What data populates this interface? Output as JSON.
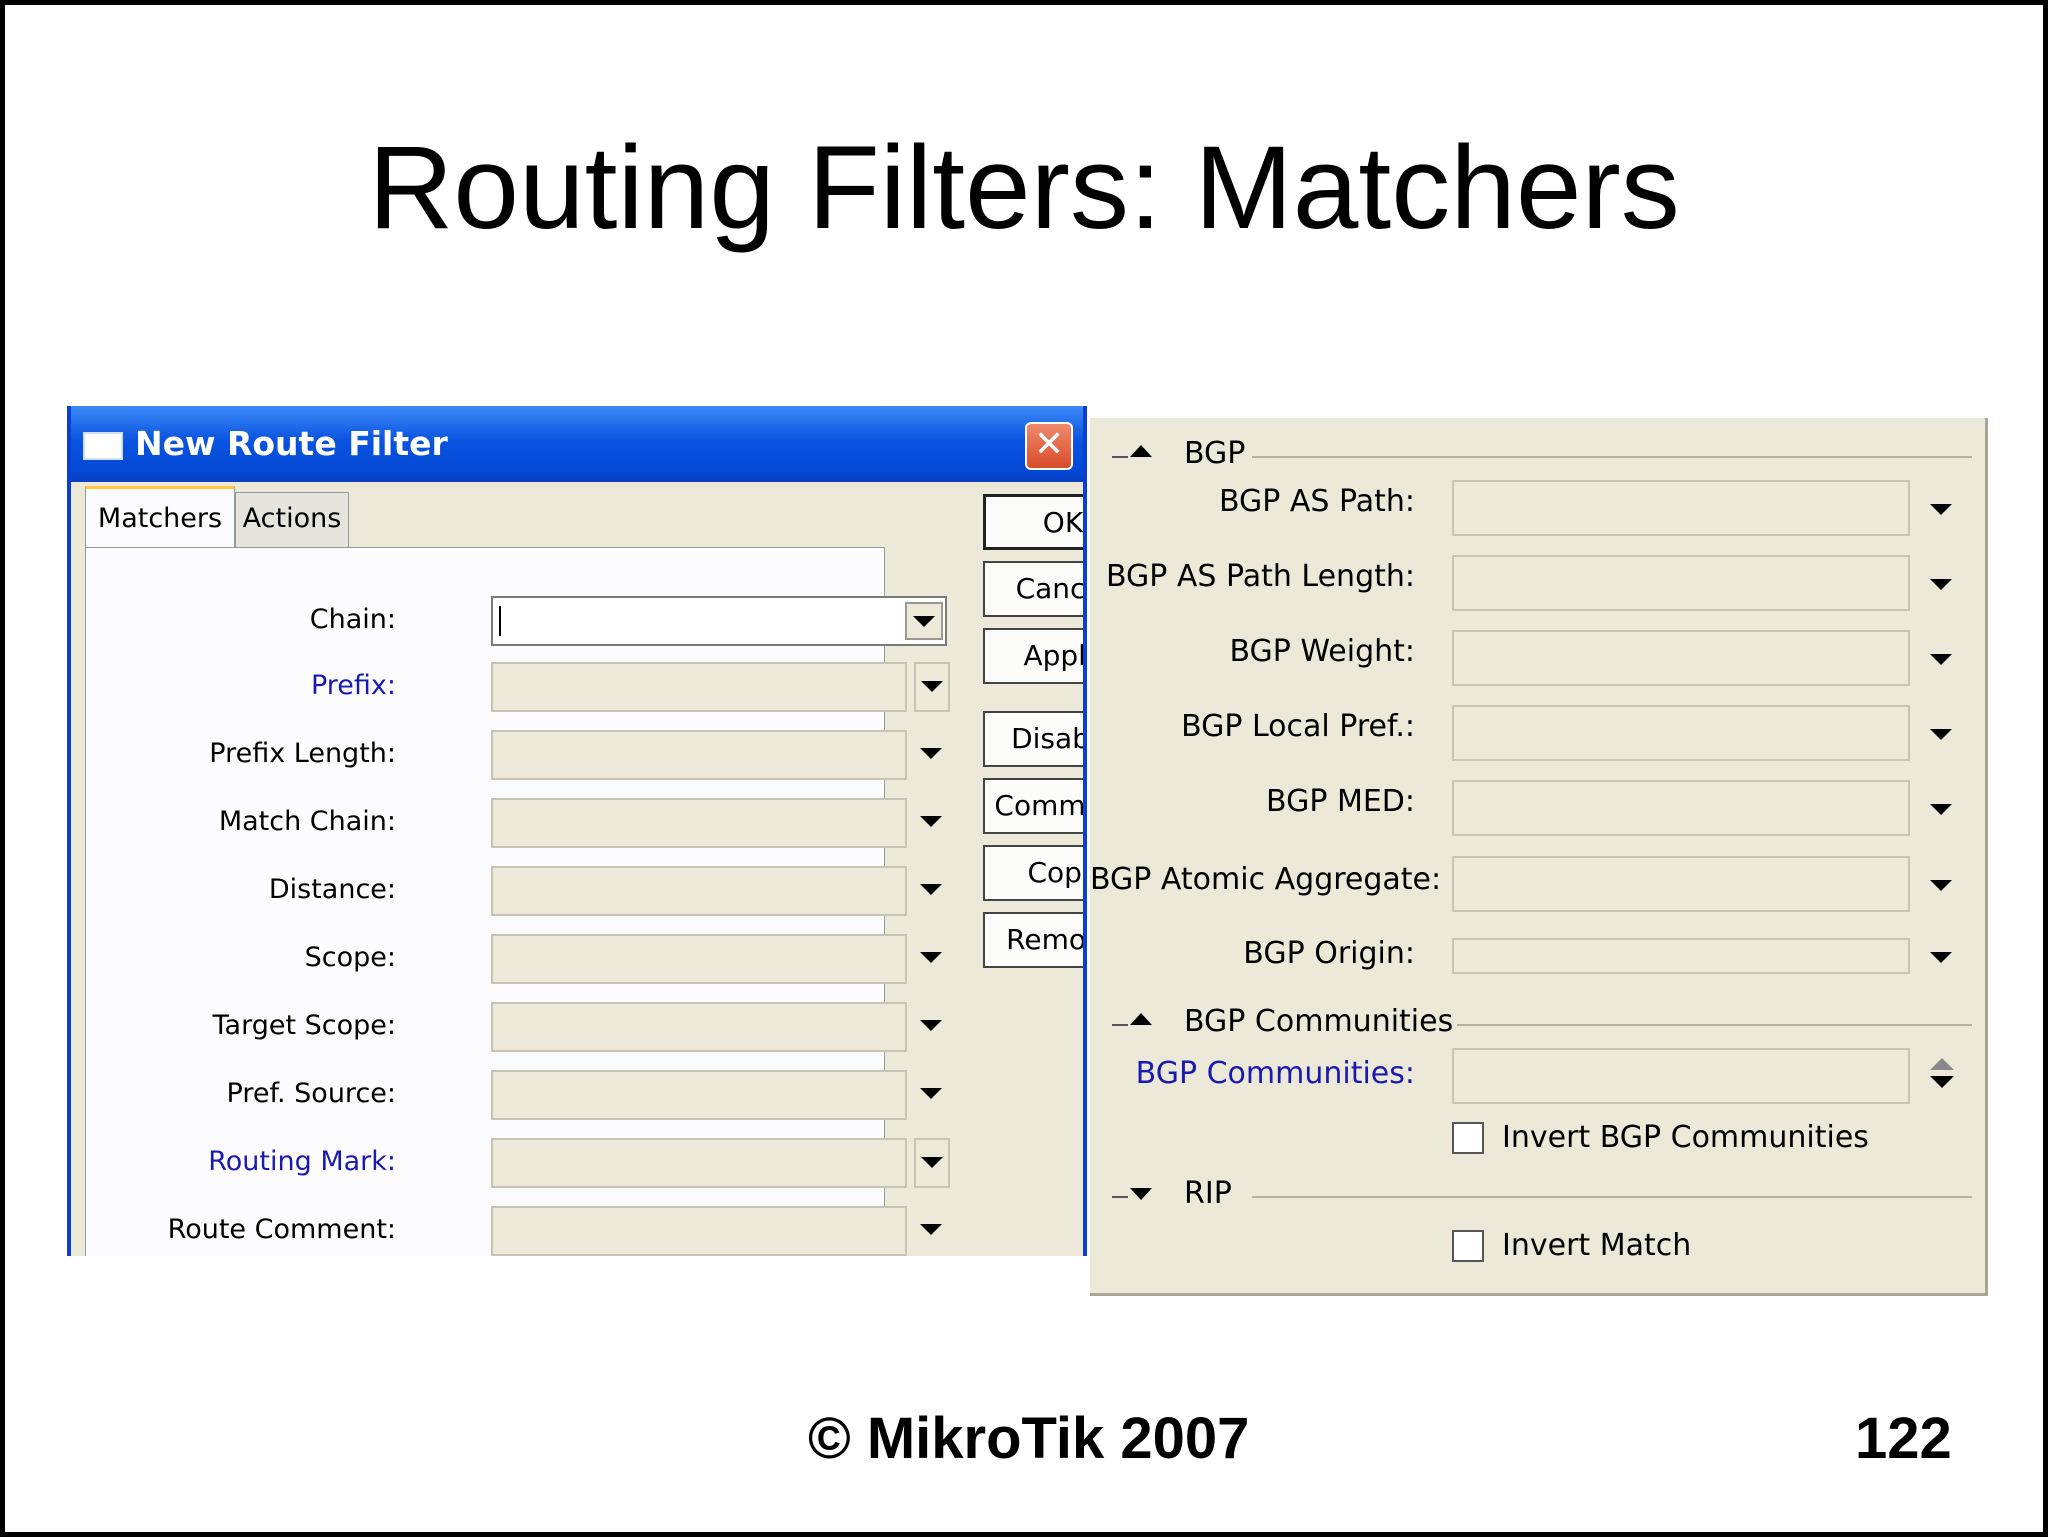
{
  "slide": {
    "title": "Routing Filters: Matchers",
    "footer_copyright": "© MikroTik 2007",
    "page_number": "122"
  },
  "window": {
    "title": "New Route Filter",
    "close_glyph": "✕",
    "tabs": [
      {
        "label": "Matchers",
        "active": true
      },
      {
        "label": "Actions",
        "active": false
      }
    ],
    "fields": {
      "chain": {
        "label": "Chain:",
        "value": ""
      },
      "prefix": {
        "label": "Prefix:",
        "value": ""
      },
      "prefix_length": {
        "label": "Prefix Length:",
        "value": ""
      },
      "match_chain": {
        "label": "Match Chain:",
        "value": ""
      },
      "distance": {
        "label": "Distance:",
        "value": ""
      },
      "scope": {
        "label": "Scope:",
        "value": ""
      },
      "target_scope": {
        "label": "Target Scope:",
        "value": ""
      },
      "pref_source": {
        "label": "Pref. Source:",
        "value": ""
      },
      "routing_mark": {
        "label": "Routing Mark:",
        "value": ""
      },
      "route_comment": {
        "label": "Route Comment:",
        "value": ""
      }
    },
    "buttons": {
      "ok": "OK",
      "cancel": "Cancel",
      "apply": "Apply",
      "disable": "Disable",
      "comment": "Comment",
      "copy": "Copy",
      "remove": "Remove"
    }
  },
  "bgp_panel": {
    "sections": {
      "bgp": "BGP",
      "bgp_communities": "BGP Communities",
      "rip": "RIP"
    },
    "fields": {
      "as_path": {
        "label": "BGP AS Path:",
        "value": ""
      },
      "as_path_length": {
        "label": "BGP AS Path Length:",
        "value": ""
      },
      "weight": {
        "label": "BGP Weight:",
        "value": ""
      },
      "local_pref": {
        "label": "BGP Local Pref.:",
        "value": ""
      },
      "med": {
        "label": "BGP MED:",
        "value": ""
      },
      "atomic_aggregate": {
        "label": "BGP Atomic Aggregate:",
        "value": ""
      },
      "origin": {
        "label": "BGP Origin:",
        "value": ""
      },
      "communities": {
        "label": "BGP Communities:",
        "value": ""
      }
    },
    "checkboxes": {
      "invert_communities": {
        "label": "Invert BGP Communities",
        "checked": false
      },
      "invert_match": {
        "label": "Invert Match",
        "checked": false
      }
    }
  }
}
